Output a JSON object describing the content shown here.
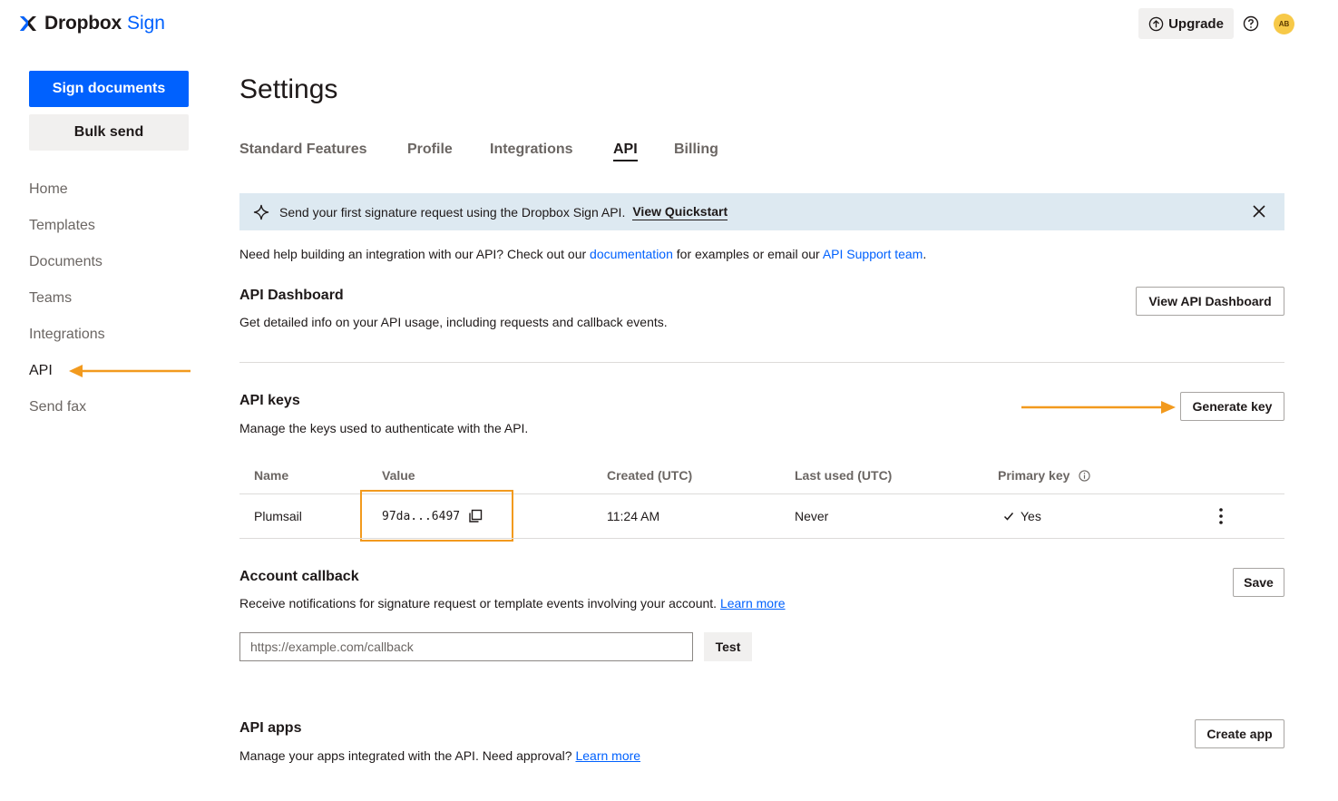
{
  "header": {
    "brand": "Dropbox",
    "brand_sub": "Sign",
    "upgrade_label": "Upgrade",
    "avatar_initials": "AB"
  },
  "sidebar": {
    "primary_button": "Sign documents",
    "secondary_button": "Bulk send",
    "items": [
      {
        "label": "Home"
      },
      {
        "label": "Templates"
      },
      {
        "label": "Documents"
      },
      {
        "label": "Teams"
      },
      {
        "label": "Integrations"
      },
      {
        "label": "API",
        "active": true
      },
      {
        "label": "Send fax"
      }
    ]
  },
  "main": {
    "title": "Settings",
    "tabs": [
      {
        "label": "Standard Features"
      },
      {
        "label": "Profile"
      },
      {
        "label": "Integrations"
      },
      {
        "label": "API",
        "active": true
      },
      {
        "label": "Billing"
      }
    ],
    "banner": {
      "text": "Send your first signature request using the Dropbox Sign API.",
      "link": "View Quickstart"
    },
    "help": {
      "prefix": "Need help building an integration with our API? Check out our",
      "doc_link": "documentation",
      "middle": "for examples or email our",
      "support_link": "API Support team",
      "suffix": "."
    },
    "dashboard": {
      "title": "API Dashboard",
      "desc": "Get detailed info on your API usage, including requests and callback events.",
      "button": "View API Dashboard"
    },
    "api_keys": {
      "title": "API keys",
      "desc": "Manage the keys used to authenticate with the API.",
      "button": "Generate key",
      "columns": [
        "Name",
        "Value",
        "Created (UTC)",
        "Last used (UTC)",
        "Primary key"
      ],
      "rows": [
        {
          "name": "Plumsail",
          "value": "97da...6497",
          "created": "11:24 AM",
          "last_used": "Never",
          "primary": "Yes"
        }
      ]
    },
    "callback": {
      "title": "Account callback",
      "desc": "Receive notifications for signature request or template events involving your account.",
      "learn_more": "Learn more",
      "save_button": "Save",
      "placeholder": "https://example.com/callback",
      "test_button": "Test"
    },
    "apps": {
      "title": "API apps",
      "desc": "Manage your apps integrated with the API. Need approval?",
      "learn_more": "Learn more",
      "button": "Create app"
    }
  },
  "colors": {
    "brand_blue": "#0061fe",
    "annotation_orange": "#f29a1e",
    "banner_bg": "#dde9f1"
  }
}
